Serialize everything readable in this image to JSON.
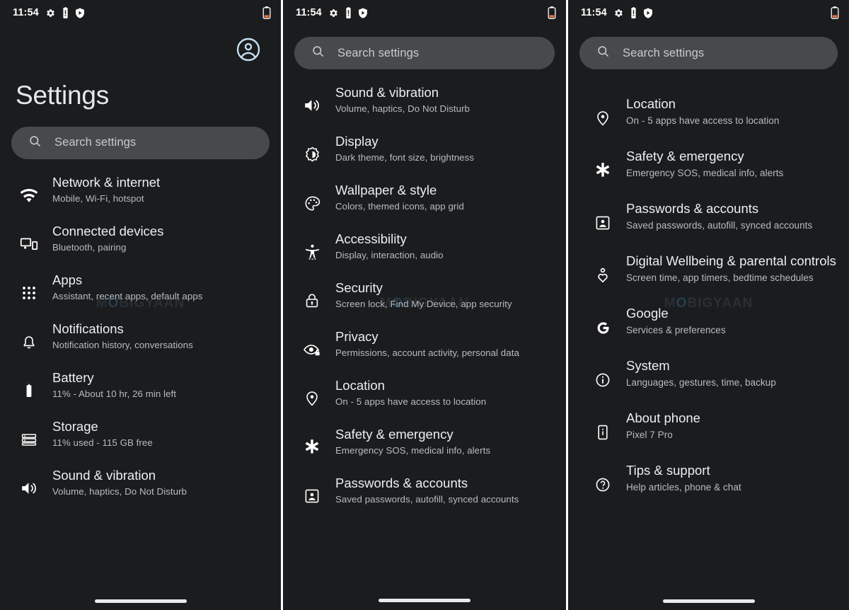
{
  "status_bar": {
    "time": "11:54",
    "left_icons": [
      "gear-icon",
      "battery-alert-icon",
      "shield-icon"
    ],
    "right_icons": [
      "battery-low-icon"
    ]
  },
  "colors": {
    "background": "#1b1c1e",
    "search_bar": "#48494c",
    "title_text": "#eceef0",
    "subtitle_text": "#b9bbbf",
    "avatar_accent": "#c5dff0",
    "battery_low": "#e8743b",
    "panel_divider": "#ffffff"
  },
  "watermark": {
    "text": "MOBIGYAAN"
  },
  "panel1": {
    "avatar_icon": "account-circle-icon",
    "title": "Settings",
    "search": {
      "placeholder": "Search settings",
      "icon": "search-icon"
    },
    "items": [
      {
        "icon": "wifi-icon",
        "title": "Network & internet",
        "subtitle": "Mobile, Wi-Fi, hotspot"
      },
      {
        "icon": "connected-devices-icon",
        "title": "Connected devices",
        "subtitle": "Bluetooth, pairing"
      },
      {
        "icon": "apps-grid-icon",
        "title": "Apps",
        "subtitle": "Assistant, recent apps, default apps"
      },
      {
        "icon": "bell-icon",
        "title": "Notifications",
        "subtitle": "Notification history, conversations"
      },
      {
        "icon": "battery-icon",
        "title": "Battery",
        "subtitle": "11% - About 10 hr, 26 min left"
      },
      {
        "icon": "storage-icon",
        "title": "Storage",
        "subtitle": "11% used - 115 GB free"
      },
      {
        "icon": "volume-icon",
        "title": "Sound & vibration",
        "subtitle": "Volume, haptics, Do Not Disturb"
      }
    ]
  },
  "panel2": {
    "search": {
      "placeholder": "Search settings",
      "icon": "search-icon"
    },
    "items": [
      {
        "icon": "volume-icon",
        "title": "Sound & vibration",
        "subtitle": "Volume, haptics, Do Not Disturb"
      },
      {
        "icon": "display-brightness-icon",
        "title": "Display",
        "subtitle": "Dark theme, font size, brightness"
      },
      {
        "icon": "palette-icon",
        "title": "Wallpaper & style",
        "subtitle": "Colors, themed icons, app grid"
      },
      {
        "icon": "accessibility-icon",
        "title": "Accessibility",
        "subtitle": "Display, interaction, audio"
      },
      {
        "icon": "lock-icon",
        "title": "Security",
        "subtitle": "Screen lock, Find My Device, app security"
      },
      {
        "icon": "privacy-eye-icon",
        "title": "Privacy",
        "subtitle": "Permissions, account activity, personal data"
      },
      {
        "icon": "location-pin-icon",
        "title": "Location",
        "subtitle": "On - 5 apps have access to location"
      },
      {
        "icon": "emergency-asterisk-icon",
        "title": "Safety & emergency",
        "subtitle": "Emergency SOS, medical info, alerts"
      },
      {
        "icon": "account-box-icon",
        "title": "Passwords & accounts",
        "subtitle": "Saved passwords, autofill, synced accounts"
      }
    ]
  },
  "panel3": {
    "search": {
      "placeholder": "Search settings",
      "icon": "search-icon"
    },
    "items": [
      {
        "icon": "location-pin-icon",
        "title": "Location",
        "subtitle": "On - 5 apps have access to location"
      },
      {
        "icon": "emergency-asterisk-icon",
        "title": "Safety & emergency",
        "subtitle": "Emergency SOS, medical info, alerts"
      },
      {
        "icon": "account-box-icon",
        "title": "Passwords & accounts",
        "subtitle": "Saved passwords, autofill, synced accounts"
      },
      {
        "icon": "digital-wellbeing-icon",
        "title": "Digital Wellbeing & parental controls",
        "subtitle": "Screen time, app timers, bedtime schedules"
      },
      {
        "icon": "google-g-icon",
        "title": "Google",
        "subtitle": "Services & preferences"
      },
      {
        "icon": "info-circle-icon",
        "title": "System",
        "subtitle": "Languages, gestures, time, backup"
      },
      {
        "icon": "phone-info-icon",
        "title": "About phone",
        "subtitle": "Pixel 7 Pro"
      },
      {
        "icon": "help-circle-icon",
        "title": "Tips & support",
        "subtitle": "Help articles, phone & chat"
      }
    ]
  }
}
